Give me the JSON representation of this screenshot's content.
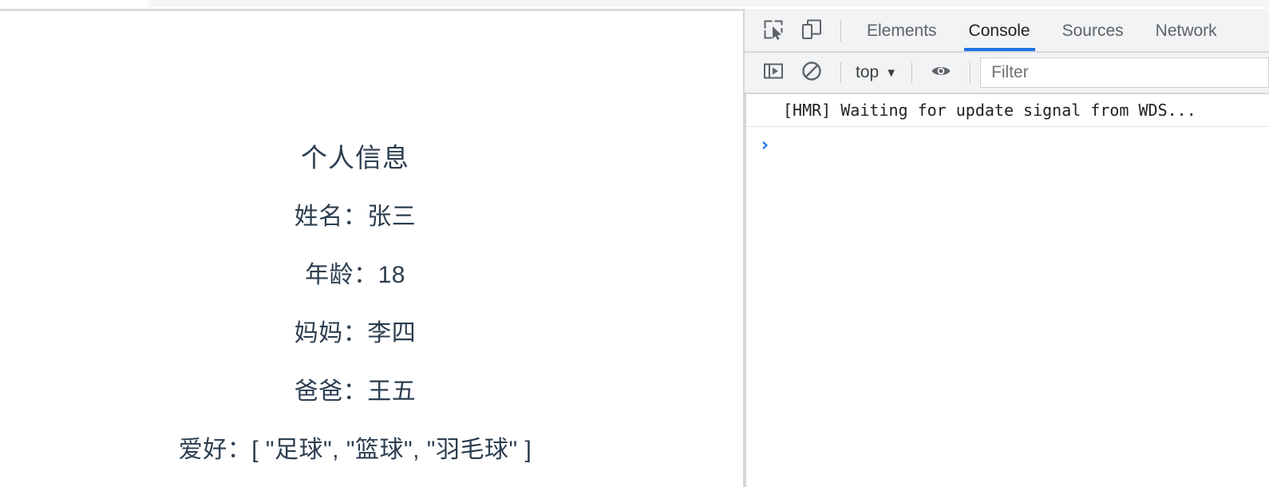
{
  "page": {
    "title": "个人信息",
    "rows": [
      {
        "label": "姓名：",
        "value": "张三"
      },
      {
        "label": "年龄：",
        "value": "18"
      },
      {
        "label": "妈妈：",
        "value": "李四"
      },
      {
        "label": "爸爸：",
        "value": "王五"
      },
      {
        "label": "爱好：",
        "value": "[ \"足球\", \"篮球\", \"羽毛球\" ]"
      }
    ],
    "text_color": "#2c3e50"
  },
  "devtools": {
    "icons": {
      "inspect": "inspect-element-icon",
      "device": "device-toolbar-icon",
      "sidebar": "console-sidebar-icon",
      "clear": "clear-console-icon",
      "eye": "live-expression-eye-icon"
    },
    "tabs": [
      {
        "label": "Elements",
        "active": false
      },
      {
        "label": "Console",
        "active": true
      },
      {
        "label": "Sources",
        "active": false
      },
      {
        "label": "Network",
        "active": false
      }
    ],
    "active_tab_underline_color": "#1a73e8",
    "toolbar": {
      "context_label": "top",
      "context_caret": "▼",
      "filter_placeholder": "Filter"
    },
    "console": {
      "messages": [
        "[HMR] Waiting for update signal from WDS..."
      ],
      "prompt_caret": "›",
      "prompt_value": ""
    }
  }
}
